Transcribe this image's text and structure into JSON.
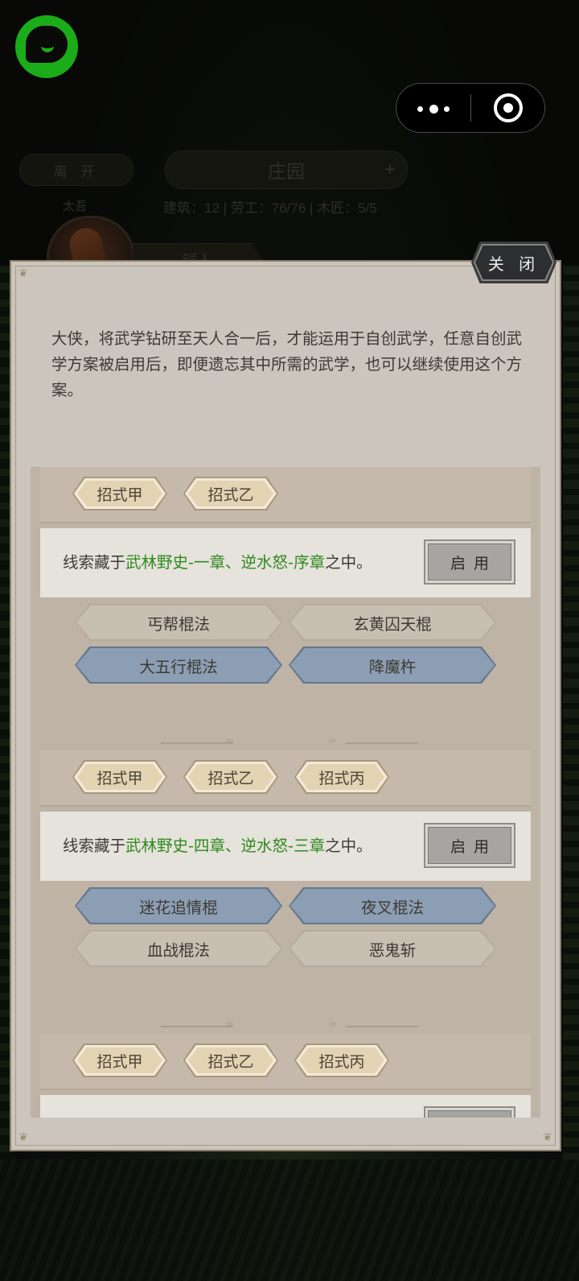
{
  "background": {
    "leave_label": "离 开",
    "manor_title": "庄园",
    "manor_plus": "+",
    "manor_stats": "建筑：12 | 劳工：76/76 | 木匠：5/5",
    "left_sub_label": "太吾",
    "character_name": "铜人"
  },
  "modal": {
    "close_label": "关 闭",
    "intro_text": "大侠，将武学钻研至天人合一后，才能运用于自创武学，任意自创武学方案被启用后，即便遗忘其中所需的武学，也可以继续使用这个方案。"
  },
  "plans": [
    {
      "moves": [
        "招式甲",
        "招式乙"
      ],
      "clue_prefix": "线索藏于",
      "clue_sources": "武林野史-一章、逆水怒-序章",
      "clue_suffix": "之中。",
      "enable_label": "启用",
      "skills": [
        {
          "name": "丐帮棍法",
          "state": "unlearned"
        },
        {
          "name": "玄黄囚天棍",
          "state": "unlearned"
        },
        {
          "name": "大五行棍法",
          "state": "learned"
        },
        {
          "name": "降魔杵",
          "state": "learned"
        }
      ]
    },
    {
      "moves": [
        "招式甲",
        "招式乙",
        "招式丙"
      ],
      "clue_prefix": "线索藏于",
      "clue_sources": "武林野史-四章、逆水怒-三章",
      "clue_suffix": "之中。",
      "enable_label": "启用",
      "skills": [
        {
          "name": "迷花追情棍",
          "state": "learned"
        },
        {
          "name": "夜叉棍法",
          "state": "learned"
        },
        {
          "name": "血战棍法",
          "state": "unlearned"
        },
        {
          "name": "恶鬼斩",
          "state": "unlearned"
        }
      ]
    },
    {
      "moves": [
        "招式甲",
        "招式乙",
        "招式丙"
      ]
    }
  ],
  "colors": {
    "clue_highlight": "#2f8a1e",
    "learned_skill": "#8c9eb3",
    "unlearned_skill": "#c8bfb3",
    "panel_bg": "#cbc5bd"
  },
  "icons": {
    "wechat_logo": "chat-bubble-icon",
    "capsule_menu": "more-dots-icon",
    "capsule_close": "target-circle-icon"
  }
}
